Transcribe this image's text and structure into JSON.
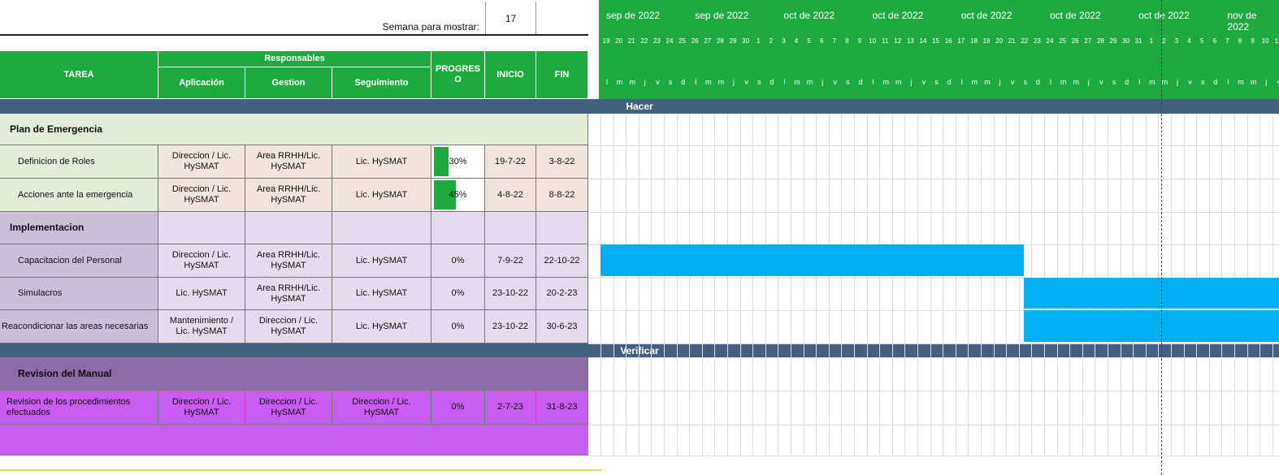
{
  "semana": {
    "label": "Semana para mostrar:",
    "value": "17"
  },
  "header": {
    "tarea": "TAREA",
    "responsables": "Responsables",
    "aplicacion": "Aplicación",
    "gestion": "Gestion",
    "seguimiento": "Seguimiento",
    "progreso": "PROGRESO",
    "inicio": "INICIO",
    "fin": "FIN"
  },
  "sections": {
    "hacer": "Hacer",
    "verificar": "Verificar"
  },
  "groups": {
    "plan": "Plan de Emergencia",
    "implementacion": "Implementacion",
    "revision": "Revision del Manual"
  },
  "rows": [
    {
      "tarea": "Definicion de Roles",
      "aplicacion": "Direccion / Lic. HySMAT",
      "gestion": "Area RRHH/Lic. HySMAT",
      "seguimiento": "Lic. HySMAT",
      "progreso": "30%",
      "progress_value": 0.3,
      "inicio": "19-7-22",
      "fin": "3-8-22"
    },
    {
      "tarea": "Acciones ante la emergencia",
      "aplicacion": "Direccion / Lic. HySMAT",
      "gestion": "Area RRHH/Lic. HySMAT",
      "seguimiento": "Lic. HySMAT",
      "progreso": "45%",
      "progress_value": 0.45,
      "inicio": "4-8-22",
      "fin": "8-8-22"
    },
    {
      "tarea": "Capacitacion del Personal",
      "aplicacion": "Direccion / Lic. HySMAT",
      "gestion": "Area RRHH/Lic. HySMAT",
      "seguimiento": "Lic. HySMAT",
      "progreso": "0%",
      "progress_value": 0,
      "inicio": "7-9-22",
      "fin": "22-10-22"
    },
    {
      "tarea": "Simulacros",
      "aplicacion": "Lic. HySMAT",
      "gestion": "Area RRHH/Lic. HySMAT",
      "seguimiento": "Lic. HySMAT",
      "progreso": "0%",
      "progress_value": 0,
      "inicio": "23-10-22",
      "fin": "20-2-23"
    },
    {
      "tarea": "Reacondicionar las areas necesarias",
      "aplicacion": "Mantenimiento / Lic. HySMAT",
      "gestion": "Direccion / Lic. HySMAT",
      "seguimiento": "Lic. HySMAT",
      "progreso": "0%",
      "progress_value": 0,
      "inicio": "23-10-22",
      "fin": "30-6-23"
    },
    {
      "tarea": "Revision de los procedimientos efectuados",
      "aplicacion": "Direccion / Lic. HySMAT",
      "gestion": "Direccion / Lic. HySMAT",
      "seguimiento": "Direccion / Lic. HySMAT",
      "progreso": "0%",
      "progress_value": 0,
      "inicio": "2-7-23",
      "fin": "31-8-23"
    }
  ],
  "timeline": {
    "months": [
      "sep de 2022",
      "sep de 2022",
      "oct de 2022",
      "oct de 2022",
      "oct de 2022",
      "oct de 2022",
      "oct de 2022",
      "nov de 2022"
    ],
    "days": [
      "19",
      "20",
      "21",
      "22",
      "23",
      "24",
      "25",
      "26",
      "27",
      "28",
      "29",
      "30",
      "1",
      "2",
      "3",
      "4",
      "5",
      "6",
      "7",
      "8",
      "9",
      "10",
      "11",
      "12",
      "13",
      "14",
      "15",
      "16",
      "17",
      "18",
      "19",
      "20",
      "21",
      "22",
      "23",
      "24",
      "25",
      "26",
      "27",
      "28",
      "29",
      "30",
      "31",
      "1",
      "2",
      "3",
      "4",
      "5",
      "6",
      "7",
      "8",
      "9",
      "10",
      "11"
    ],
    "weekdays": [
      "l",
      "m",
      "m",
      "j",
      "v",
      "s",
      "d"
    ]
  },
  "colors": {
    "header_green": "#1faa3f",
    "section_blue": "#44607f",
    "plan_bg": "#e2ecd6",
    "plan_rows": "#f0e4dc",
    "impl_bg": "#c9bfd9",
    "impl_rows": "#e4dcec",
    "rev_bg": "#8d6aa8",
    "rev_rows": "#c95cf2",
    "gantt_bar": "#00aeef"
  }
}
